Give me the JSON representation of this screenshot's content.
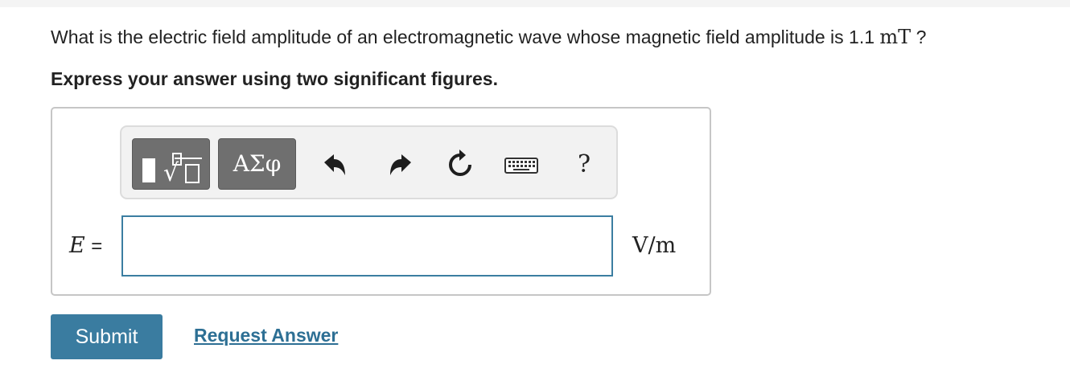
{
  "question": {
    "text": "What is the electric field amplitude of an electromagnetic wave whose magnetic field amplitude is 1.1",
    "unit": "mT",
    "suffix": "?"
  },
  "instruction": "Express your answer using two significant figures.",
  "toolbar": {
    "templates_icon": "templates-icon",
    "greek_label": "ΑΣφ",
    "undo_icon": "undo-icon",
    "redo_icon": "redo-icon",
    "reset_icon": "reset-icon",
    "keyboard_icon": "keyboard-icon",
    "help_label": "?"
  },
  "answer": {
    "variable": "E",
    "equals": "=",
    "value": "",
    "unit": "V/m"
  },
  "actions": {
    "submit_label": "Submit",
    "request_answer_label": "Request Answer"
  },
  "colors": {
    "accent": "#3a7ca0",
    "link": "#2d6f94",
    "toolbar_button": "#6f6f6f",
    "input_border": "#3b7ea1"
  }
}
